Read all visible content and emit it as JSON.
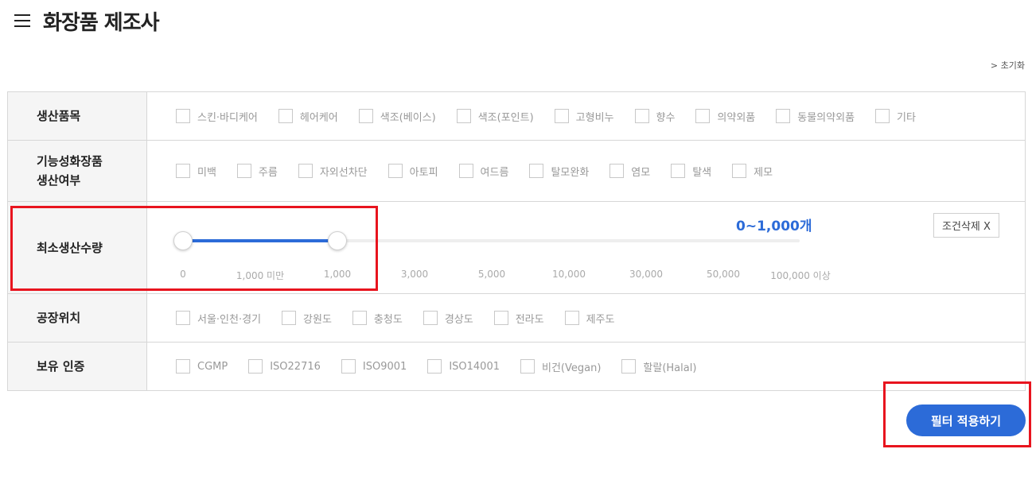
{
  "header": {
    "title": "화장품 제조사",
    "menu_icon": "hamburger-menu-icon"
  },
  "reset_link": "> 초기화",
  "rows": {
    "product": {
      "label": "생산품목",
      "options": [
        "스킨·바디케어",
        "헤어케어",
        "색조(베이스)",
        "색조(포인트)",
        "고형비누",
        "향수",
        "의약외품",
        "동물의약외품",
        "기타"
      ]
    },
    "functional": {
      "label_line1": "기능성화장품",
      "label_line2": "생산여부",
      "options": [
        "미백",
        "주름",
        "자외선차단",
        "아토피",
        "여드름",
        "탈모완화",
        "염모",
        "탈색",
        "제모"
      ]
    },
    "quantity": {
      "label": "최소생산수량",
      "range_value": "0~1,000개",
      "clear_label": "조건삭제 X",
      "selected_fraction": [
        0.0,
        0.25
      ],
      "ticks": [
        "0",
        "1,000 미만",
        "1,000",
        "3,000",
        "5,000",
        "10,000",
        "30,000",
        "50,000",
        "100,000 이상"
      ]
    },
    "factory": {
      "label": "공장위치",
      "options": [
        "서울·인천·경기",
        "강원도",
        "충청도",
        "경상도",
        "전라도",
        "제주도"
      ]
    },
    "cert": {
      "label": "보유 인증",
      "options": [
        "CGMP",
        "ISO22716",
        "ISO9001",
        "ISO14001",
        "비건(Vegan)",
        "할랄(Halal)"
      ]
    }
  },
  "apply_button": "필터 적용하기",
  "colors": {
    "accent": "#2c6bd8",
    "highlight": "#e8141e",
    "label_bg": "#f5f5f5",
    "border": "#d7d7d7"
  }
}
